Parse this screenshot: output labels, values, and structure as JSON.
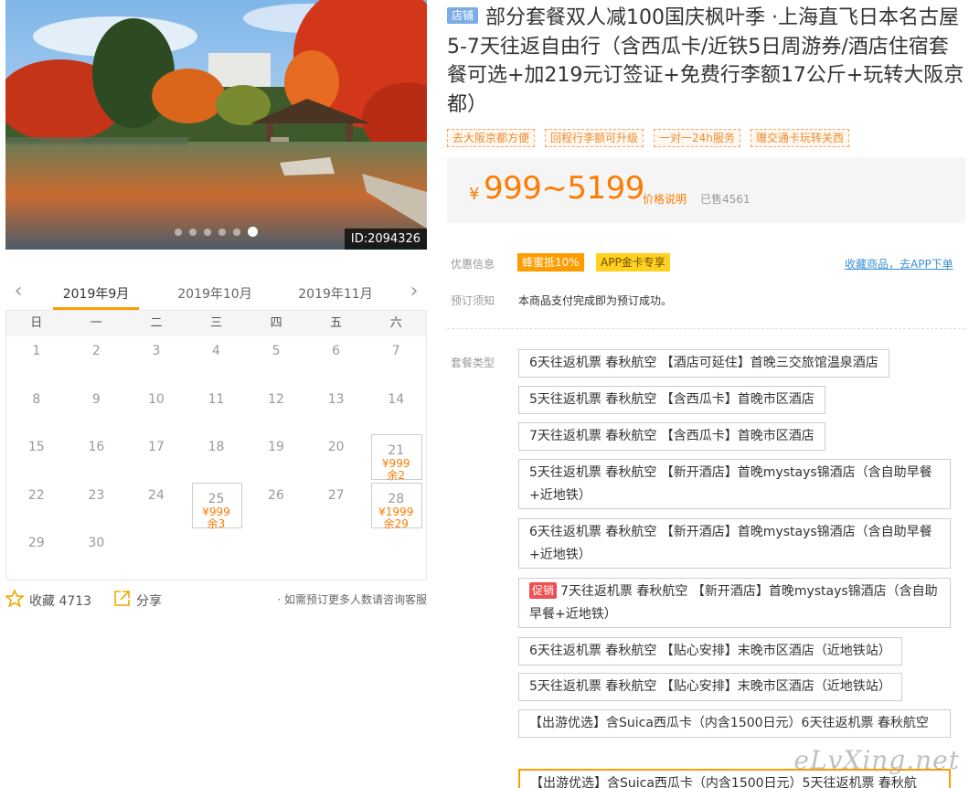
{
  "hero": {
    "id_tag": "ID:2094326",
    "slides": 6,
    "active_slide": 5
  },
  "calendar": {
    "months": [
      "2019年9月",
      "2019年10月",
      "2019年11月"
    ],
    "weekdays": [
      "日",
      "一",
      "二",
      "三",
      "四",
      "五",
      "六"
    ],
    "days": [
      {
        "d": "1"
      },
      {
        "d": "2"
      },
      {
        "d": "3"
      },
      {
        "d": "4"
      },
      {
        "d": "5"
      },
      {
        "d": "6"
      },
      {
        "d": "7"
      },
      {
        "d": "8"
      },
      {
        "d": "9"
      },
      {
        "d": "10"
      },
      {
        "d": "11"
      },
      {
        "d": "12"
      },
      {
        "d": "13"
      },
      {
        "d": "14"
      },
      {
        "d": "15"
      },
      {
        "d": "16"
      },
      {
        "d": "17"
      },
      {
        "d": "18"
      },
      {
        "d": "19"
      },
      {
        "d": "20"
      },
      {
        "d": "21",
        "price": "¥999",
        "left": "余2"
      },
      {
        "d": "22"
      },
      {
        "d": "23"
      },
      {
        "d": "24"
      },
      {
        "d": "25",
        "price": "¥999",
        "left": "余3"
      },
      {
        "d": "26"
      },
      {
        "d": "27"
      },
      {
        "d": "28",
        "price": "¥1999",
        "left": "余29"
      },
      {
        "d": "29"
      },
      {
        "d": "30"
      }
    ]
  },
  "actions": {
    "fav": "收藏 4713",
    "share": "分享",
    "tip": "· 如需预订更多人数请咨询客服"
  },
  "product": {
    "shop_tag": "店铺",
    "title": "部分套餐双人减100国庆枫叶季 ·上海直飞日本名古屋5-7天往返自由行（含西瓜卡/近铁5日周游券/酒店住宿套餐可选+加219元订签证+免费行李额17公斤+玩转大阪京都）",
    "tags": [
      "去大阪京都方便",
      "回程行李额可升级",
      "一对一24h服务",
      "赠交通卡玩转关西"
    ],
    "currency": "¥",
    "price": "999~5199",
    "price_explain": "价格说明",
    "sold": "已售4561",
    "discount_label": "优惠信息",
    "promos": [
      "蜂蜜抵10%",
      "APP金卡专享"
    ],
    "fav_link": "收藏商品，去APP下单",
    "notice_label": "预订须知",
    "notice": "本商品支付完成即为预订成功。",
    "package_label": "套餐类型",
    "packages": [
      {
        "text": "6天往返机票 春秋航空 【酒店可延住】首晚三交旅馆温泉酒店"
      },
      {
        "text": "5天往返机票 春秋航空 【含西瓜卡】首晚市区酒店"
      },
      {
        "text": "7天往返机票 春秋航空 【含西瓜卡】首晚市区酒店"
      },
      {
        "text": "5天往返机票 春秋航空 【新开酒店】首晚mystays锦酒店（含自助早餐+近地铁）"
      },
      {
        "text": "6天往返机票 春秋航空 【新开酒店】首晚mystays锦酒店（含自助早餐+近地铁）"
      },
      {
        "badge": "促销",
        "text": "7天往返机票 春秋航空 【新开酒店】首晚mystays锦酒店（含自助早餐+近地铁）"
      },
      {
        "text": "6天往返机票 春秋航空 【贴心安排】末晚市区酒店（近地铁站）"
      },
      {
        "text": "5天往返机票 春秋航空 【贴心安排】末晚市区酒店（近地铁站）"
      },
      {
        "text": "【出游优选】含Suica西瓜卡（内含1500日元）6天往返机票 春秋航空"
      },
      {
        "text": "【出游优选】含Suica西瓜卡（内含1500日元）5天往返机票 春秋航"
      }
    ]
  },
  "watermark": "eLvXing.net",
  "colors": {
    "accent": "#ff9d00",
    "price": "#ff7a00",
    "link": "#3b8fd8",
    "shop_tag": "#7bace6",
    "promo_red": "#ef4f4f"
  }
}
